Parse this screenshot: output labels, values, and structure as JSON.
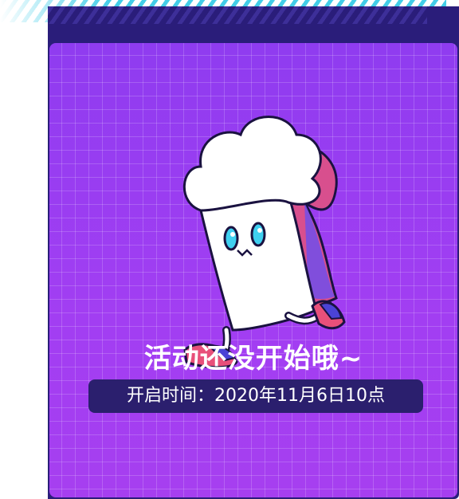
{
  "status": {
    "headline": "活动还没开始哦~",
    "start_time_label": "开启时间：2020年11月6日10点"
  },
  "colors": {
    "card_purple": "#9a3cf0",
    "frame_navy": "#2a1d7a",
    "pill_navy": "#2b1f6e",
    "stripe_cyan": "#2ec8e6",
    "accent_pink": "#e8507a"
  },
  "illustration": {
    "icon": "running-mascot-illustration"
  }
}
